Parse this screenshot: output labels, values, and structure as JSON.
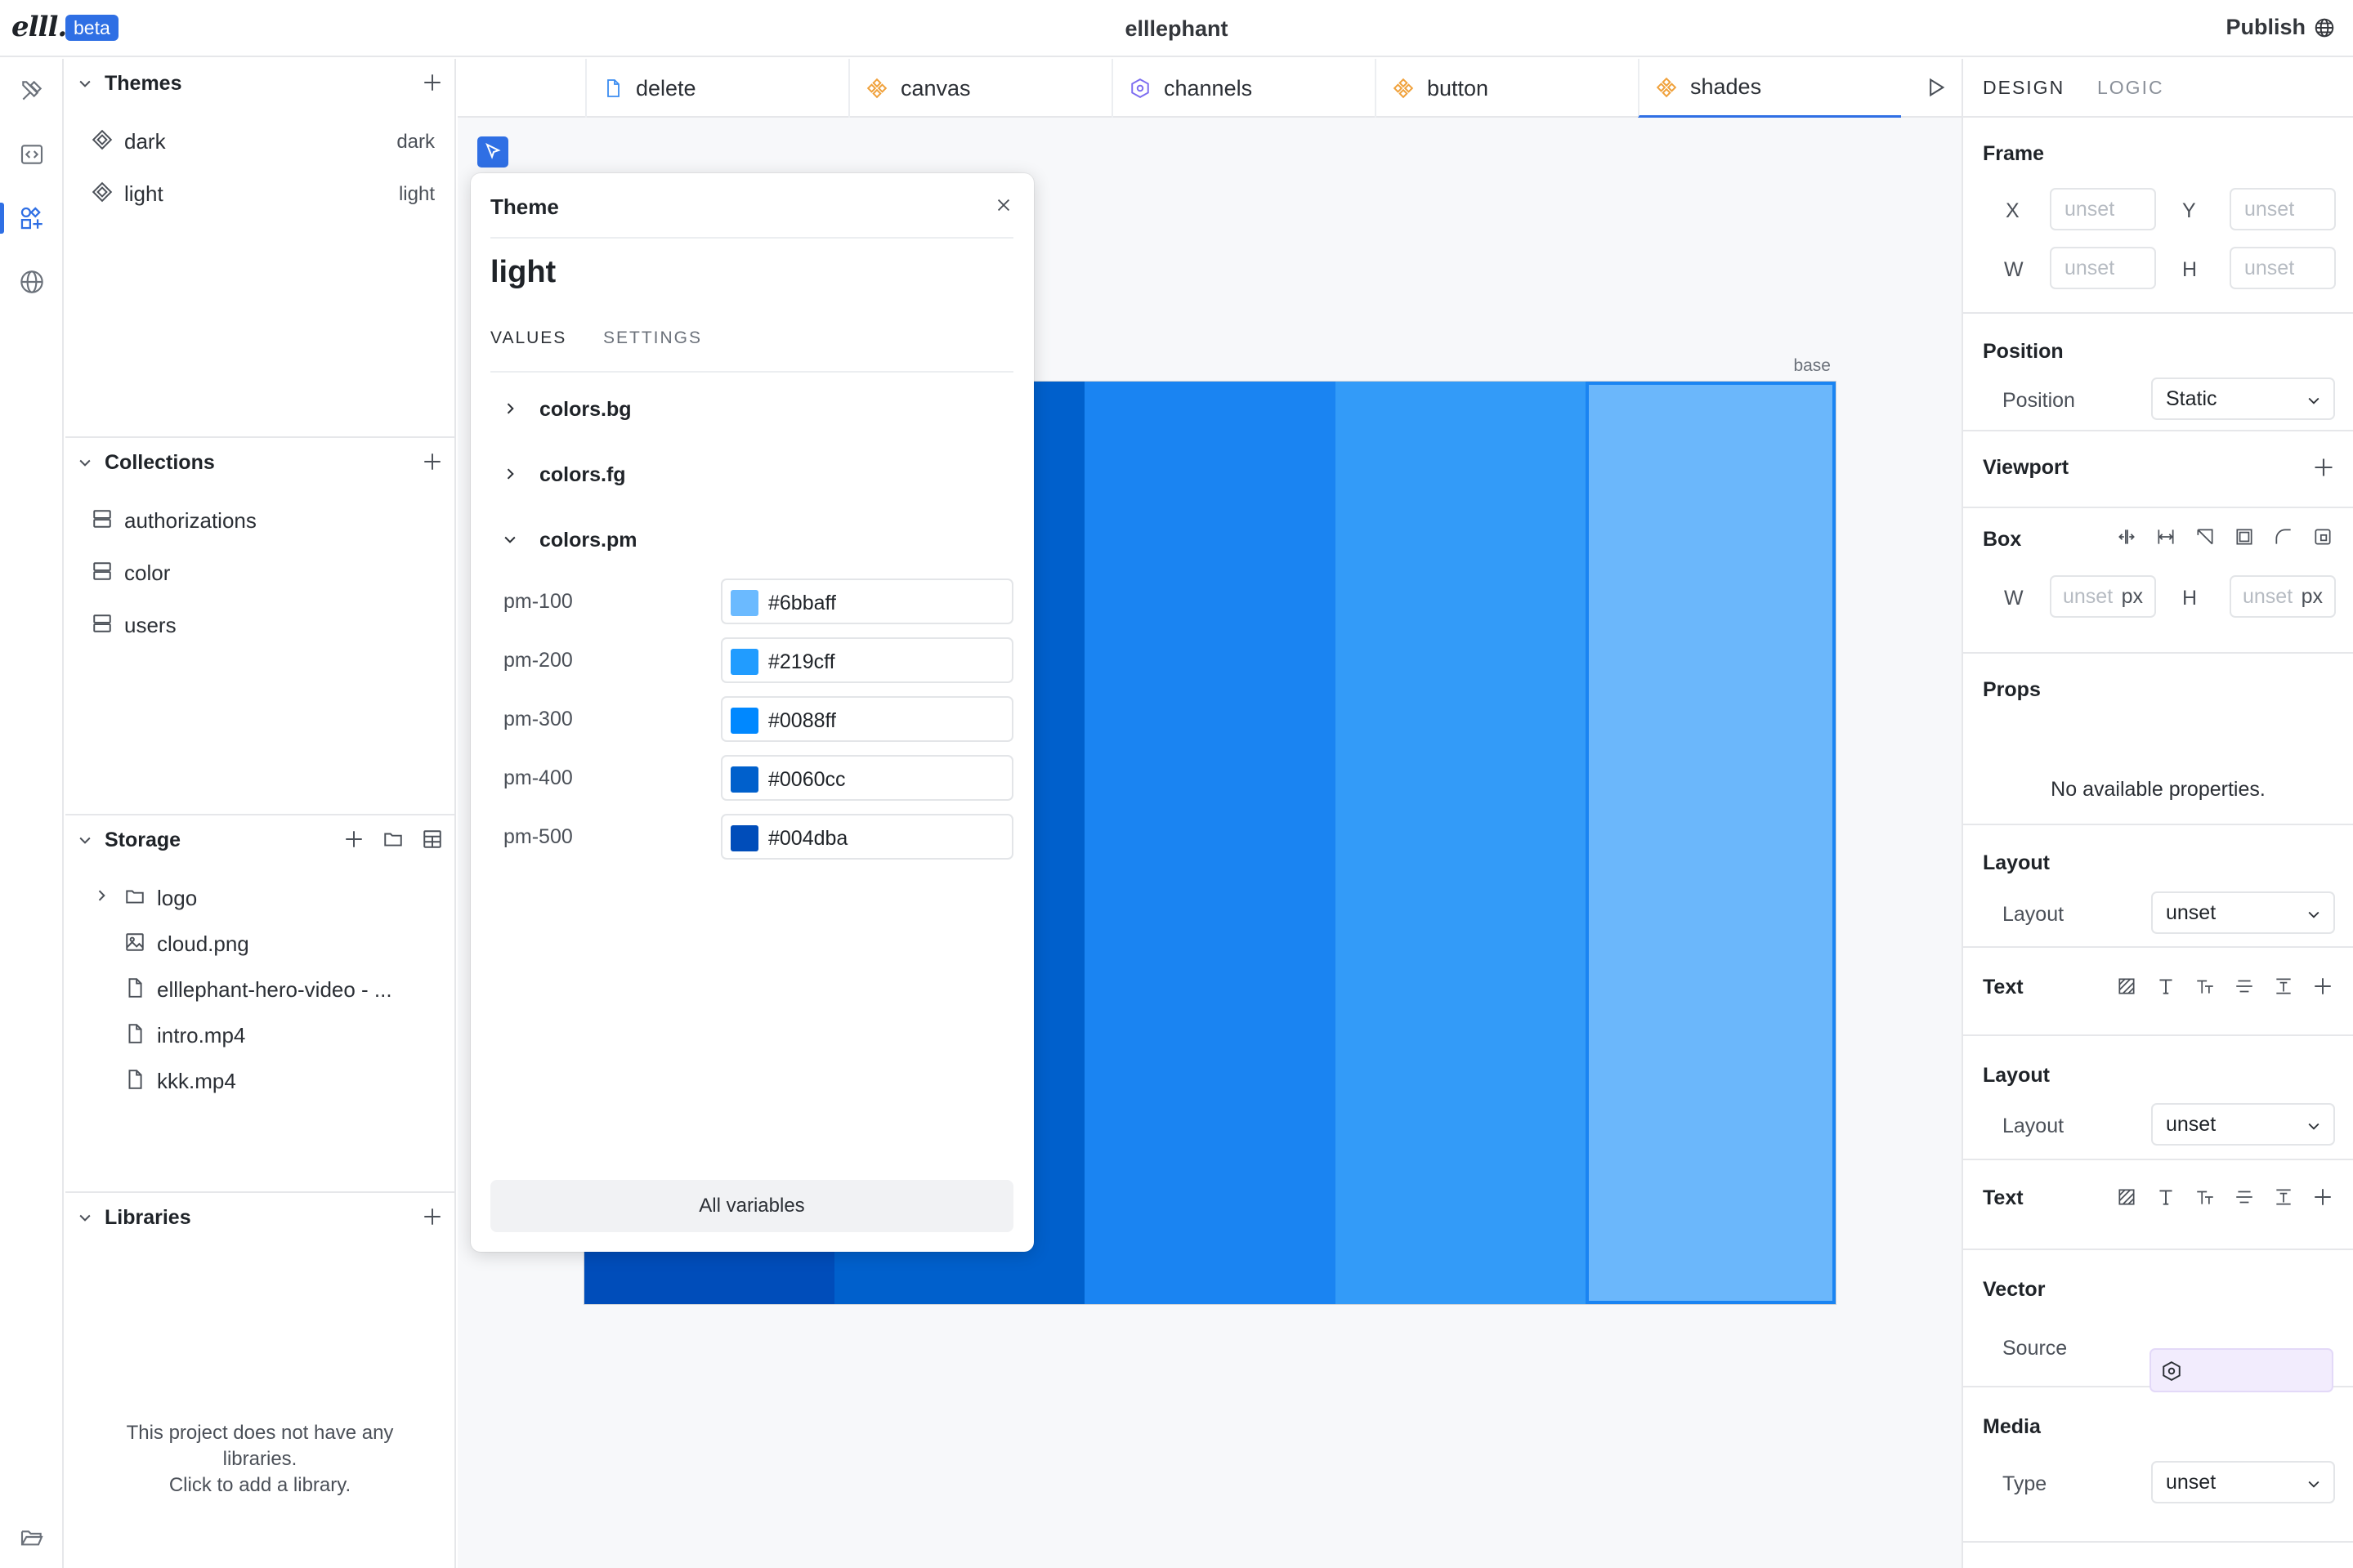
{
  "app": {
    "logo": "elll.",
    "badge": "beta",
    "title": "elllephant",
    "publish_label": "Publish"
  },
  "rail": [
    {
      "name": "tools-icon"
    },
    {
      "name": "code-icon"
    },
    {
      "name": "components-icon",
      "active": true
    },
    {
      "name": "globe-icon"
    }
  ],
  "sidebar": {
    "themes": {
      "title": "Themes",
      "items": [
        {
          "label": "dark",
          "value": "dark"
        },
        {
          "label": "light",
          "value": "light"
        }
      ]
    },
    "collections": {
      "title": "Collections",
      "items": [
        {
          "label": "authorizations"
        },
        {
          "label": "color"
        },
        {
          "label": "users"
        }
      ]
    },
    "storage": {
      "title": "Storage",
      "items": [
        {
          "label": "logo",
          "type": "folder"
        },
        {
          "label": "cloud.png",
          "type": "image"
        },
        {
          "label": "elllephant-hero-video - ...",
          "type": "file"
        },
        {
          "label": "intro.mp4",
          "type": "file"
        },
        {
          "label": "kkk.mp4",
          "type": "file"
        }
      ]
    },
    "libraries": {
      "title": "Libraries",
      "empty_line1": "This project does not have any",
      "empty_line2": "libraries.",
      "empty_line3": "Click to add a library."
    }
  },
  "tabs": [
    {
      "label": "delete",
      "icon": "page-icon",
      "color": "#3b8cf0"
    },
    {
      "label": "canvas",
      "icon": "component-icon",
      "color": "#f0a13b"
    },
    {
      "label": "channels",
      "icon": "hexagon-icon",
      "color": "#7c6cf0"
    },
    {
      "label": "button",
      "icon": "component-icon",
      "color": "#f0a13b"
    },
    {
      "label": "shades",
      "icon": "component-icon",
      "color": "#f0a13b",
      "active": true
    }
  ],
  "canvas": {
    "frame_label": "base",
    "shades": [
      "#004dba",
      "#0060cc",
      "#1a84f2",
      "#339bf8",
      "#6bb7fb"
    ]
  },
  "theme_popover": {
    "title": "Theme",
    "name": "light",
    "tabs": [
      "VALUES",
      "SETTINGS"
    ],
    "groups": [
      {
        "label": "colors.bg",
        "expanded": false
      },
      {
        "label": "colors.fg",
        "expanded": false
      },
      {
        "label": "colors.pm",
        "expanded": true
      }
    ],
    "variables": [
      {
        "name": "pm-100",
        "value": "#6bbaff",
        "color": "#6bbaff"
      },
      {
        "name": "pm-200",
        "value": "#219cff",
        "color": "#219cff"
      },
      {
        "name": "pm-300",
        "value": "#0088ff",
        "color": "#0088ff"
      },
      {
        "name": "pm-400",
        "value": "#0060cc",
        "color": "#0060cc"
      },
      {
        "name": "pm-500",
        "value": "#004dba",
        "color": "#004dba"
      }
    ],
    "all_variables_label": "All variables"
  },
  "inspector": {
    "tabs": [
      "DESIGN",
      "LOGIC"
    ],
    "frame": {
      "title": "Frame",
      "x_label": "X",
      "y_label": "Y",
      "w_label": "W",
      "h_label": "H",
      "x": "unset",
      "y": "unset",
      "w": "unset",
      "h": "unset"
    },
    "position": {
      "title": "Position",
      "label": "Position",
      "value": "Static"
    },
    "viewport": {
      "title": "Viewport"
    },
    "box": {
      "title": "Box",
      "w_label": "W",
      "h_label": "H",
      "w": "unset",
      "h": "unset",
      "unit": "px"
    },
    "props": {
      "title": "Props",
      "empty": "No available properties."
    },
    "layout1": {
      "title": "Layout",
      "label": "Layout",
      "value": "unset"
    },
    "text1": {
      "title": "Text"
    },
    "layout2": {
      "title": "Layout",
      "label": "Layout",
      "value": "unset"
    },
    "text2": {
      "title": "Text"
    },
    "vector": {
      "title": "Vector",
      "label": "Source"
    },
    "media": {
      "title": "Media",
      "label": "Type",
      "value": "unset"
    }
  },
  "colors": {
    "accent": "#2f6fe4",
    "selection": "#1a84f2",
    "vector_bg": "#f2ecfd"
  }
}
